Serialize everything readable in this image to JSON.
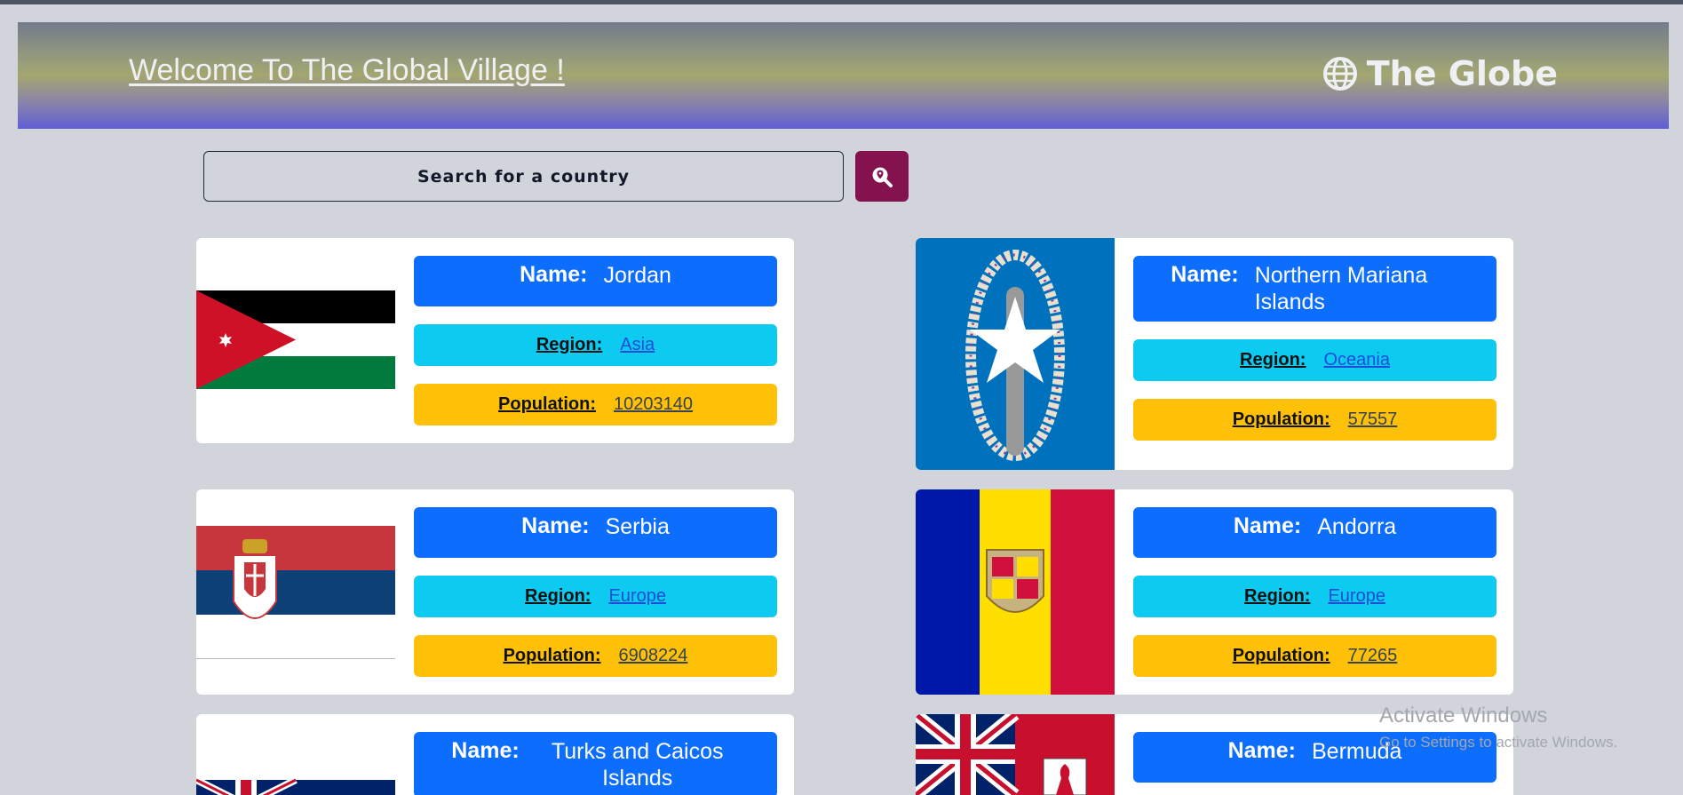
{
  "header": {
    "title": "Welcome To The Global Village !",
    "brand": "The Globe",
    "brand_icon": "globe-icon"
  },
  "search": {
    "placeholder": "Search for a country",
    "button_icon": "map-pin-search-icon",
    "button_color": "#84124e"
  },
  "labels": {
    "name": "Name:",
    "region": "Region:",
    "population": "Population:"
  },
  "colors": {
    "name_pill": "#0d6efd",
    "region_pill": "#0dcaf0",
    "population_pill": "#ffc107"
  },
  "countries": [
    {
      "name": "Jordan",
      "region": "Asia",
      "population": "10203140",
      "flag": "jordan-flag-icon"
    },
    {
      "name": "Northern Mariana Islands",
      "region": "Oceania",
      "population": "57557",
      "flag": "northern-mariana-islands-flag-icon"
    },
    {
      "name": "Serbia",
      "region": "Europe",
      "population": "6908224",
      "flag": "serbia-flag-icon"
    },
    {
      "name": "Andorra",
      "region": "Europe",
      "population": "77265",
      "flag": "andorra-flag-icon"
    },
    {
      "name": "Turks and Caicos Islands",
      "flag": "turks-and-caicos-flag-icon"
    },
    {
      "name": "Bermuda",
      "flag": "bermuda-flag-icon"
    }
  ],
  "watermark": {
    "line1": "Activate Windows",
    "line2": "Go to Settings to activate Windows."
  }
}
